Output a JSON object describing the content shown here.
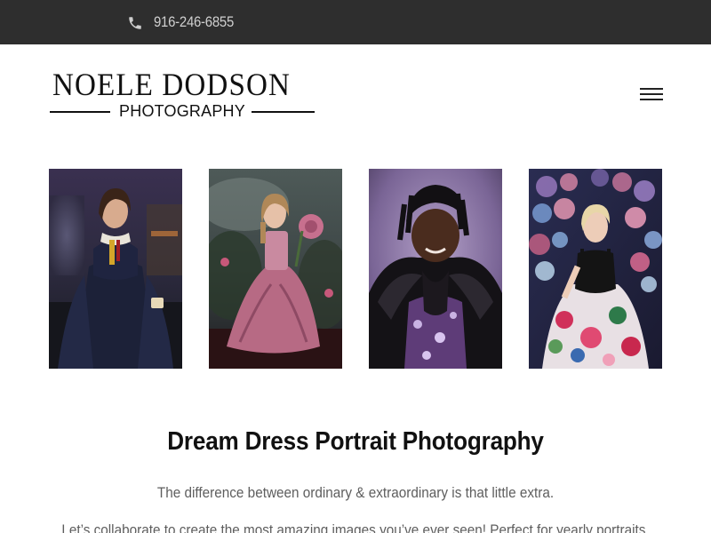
{
  "topbar": {
    "phone_icon": "phone-icon",
    "phone_number": "916-246-6855",
    "background": "#2e2e2e"
  },
  "logo": {
    "main": "NOELE DODSON",
    "sub": "PHOTOGRAPHY"
  },
  "nav": {
    "menu_icon": "hamburger-menu-icon"
  },
  "gallery": [
    {
      "subject": "girl in navy gown"
    },
    {
      "subject": "girl in pink gown"
    },
    {
      "subject": "girl in black ruffled dress"
    },
    {
      "subject": "woman in floral dress"
    }
  ],
  "content": {
    "title": "Dream Dress Portrait Photography",
    "tagline": "The difference between ordinary & extraordinary is that little extra.",
    "intro": "Let’s collaborate to create the most amazing images you’ve ever seen! Perfect for yearly portraits,"
  }
}
